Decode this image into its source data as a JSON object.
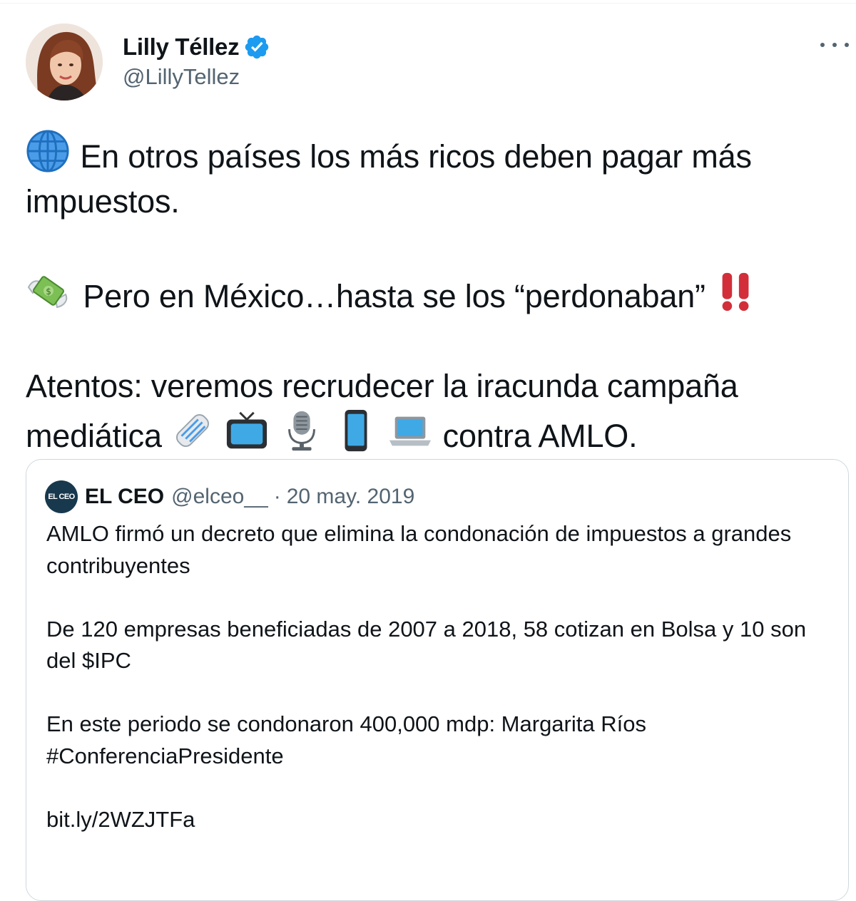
{
  "author": {
    "name": "Lilly Téllez",
    "handle": "@LillyTellez",
    "avatar_icon": "avatar-photo",
    "verified_icon": "verified-badge-icon"
  },
  "tweet": {
    "line1_icon": "globe-icon",
    "line1": "En otros países los más ricos deben pagar más impuestos.",
    "line2_icon": "money-with-wings-icon",
    "line2": "Pero en México…hasta se los “perdonaban”",
    "line2_end_icon": "double-exclamation-icon",
    "line3": "Atentos: veremos recrudecer la iracunda campaña mediática",
    "line3_icons": [
      "newspaper-icon",
      "tv-icon",
      "microphone-icon",
      "mobile-phone-icon",
      "laptop-icon"
    ],
    "line3_end": "contra AMLO."
  },
  "quoted": {
    "logo_text": "EL CEO",
    "name": "EL CEO",
    "handle": "@elceo__",
    "separator": "·",
    "date": "20 may. 2019",
    "paragraph1": "AMLO firmó un decreto que elimina la condonación de impuestos a grandes contribuyentes",
    "paragraph2": "De 120 empresas beneficiadas de 2007 a 2018, 58 cotizan en Bolsa y 10 son del $IPC",
    "paragraph3": "En este periodo se condonaron 400,000 mdp: Margarita Ríos #ConferenciaPresidente",
    "link": "bit.ly/2WZJTFa"
  },
  "colors": {
    "text": "#0f1419",
    "secondary": "#536471",
    "verified": "#1d9bf0",
    "border": "#cfd9de"
  }
}
